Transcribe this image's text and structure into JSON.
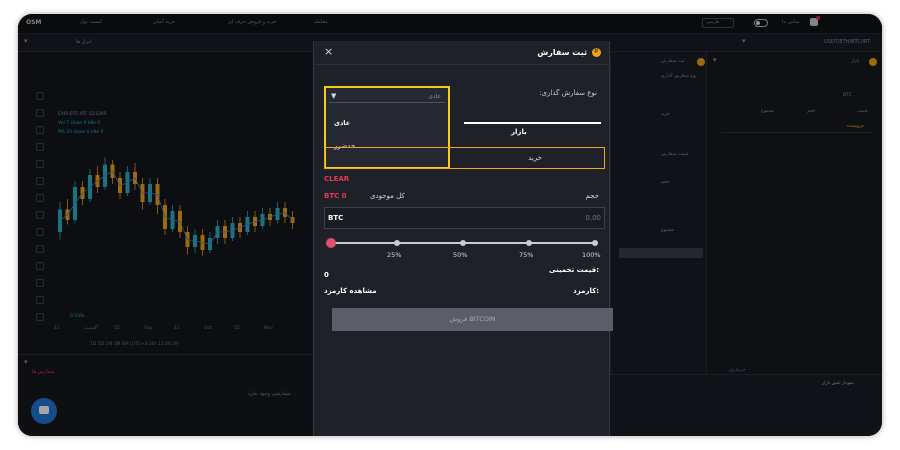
{
  "topbar": {
    "logo": "OSM",
    "items": [
      "لیست پول",
      "خرید آسان",
      "خرید و فروش حرفه ای",
      "معامله"
    ],
    "language": "فارسی",
    "user": "تماس ما"
  },
  "bar2": {
    "left_label": "ابزار ها",
    "pair": "USDT/ETH/BTC/IRT"
  },
  "chart": {
    "ohlc_1": "EXIR:BTC-IRT  1D  EXIR",
    "ohlc_2": "Vol 7 close 0 Idle 0",
    "ohlc_3": "MA 25 close 0 Idle 0",
    "pct": "0.53%",
    "x_labels": [
      "15",
      "آگوست",
      "15",
      "Sep",
      "15",
      "Oct",
      "15",
      "Nov"
    ],
    "range_text": "1D  5D  1M  3M  6M  (UTC+3:30)  12:06:39",
    "candles": [
      [
        0.4,
        0.55,
        0.35,
        0.6
      ],
      [
        0.55,
        0.48,
        0.45,
        0.62
      ],
      [
        0.48,
        0.7,
        0.46,
        0.74
      ],
      [
        0.7,
        0.62,
        0.58,
        0.74
      ],
      [
        0.62,
        0.78,
        0.6,
        0.82
      ],
      [
        0.78,
        0.7,
        0.66,
        0.84
      ],
      [
        0.7,
        0.85,
        0.68,
        0.9
      ],
      [
        0.85,
        0.76,
        0.72,
        0.88
      ],
      [
        0.76,
        0.66,
        0.62,
        0.8
      ],
      [
        0.66,
        0.8,
        0.64,
        0.84
      ],
      [
        0.8,
        0.72,
        0.68,
        0.86
      ],
      [
        0.72,
        0.6,
        0.55,
        0.76
      ],
      [
        0.6,
        0.72,
        0.58,
        0.76
      ],
      [
        0.72,
        0.58,
        0.52,
        0.76
      ],
      [
        0.58,
        0.42,
        0.38,
        0.62
      ],
      [
        0.42,
        0.54,
        0.4,
        0.58
      ],
      [
        0.54,
        0.4,
        0.36,
        0.58
      ],
      [
        0.4,
        0.3,
        0.25,
        0.44
      ],
      [
        0.3,
        0.38,
        0.26,
        0.42
      ],
      [
        0.38,
        0.28,
        0.24,
        0.42
      ],
      [
        0.28,
        0.36,
        0.26,
        0.4
      ],
      [
        0.36,
        0.44,
        0.32,
        0.48
      ],
      [
        0.44,
        0.36,
        0.32,
        0.48
      ],
      [
        0.36,
        0.46,
        0.34,
        0.5
      ],
      [
        0.46,
        0.4,
        0.36,
        0.5
      ],
      [
        0.4,
        0.5,
        0.38,
        0.54
      ],
      [
        0.5,
        0.44,
        0.4,
        0.54
      ],
      [
        0.44,
        0.52,
        0.42,
        0.56
      ],
      [
        0.52,
        0.48,
        0.44,
        0.56
      ],
      [
        0.48,
        0.56,
        0.46,
        0.6
      ],
      [
        0.56,
        0.5,
        0.46,
        0.6
      ],
      [
        0.5,
        0.46,
        0.42,
        0.54
      ]
    ]
  },
  "bottom": {
    "title": "سفارش های باز",
    "empty": "سفارشی وجود ندارد",
    "tab": "سفارش ها"
  },
  "modal": {
    "title": "ثبت سفارش",
    "order_type_label": "نوع سفارش گذاری:",
    "dropdown_value": "عادی",
    "option_1": "عادی",
    "option_2": "حدضرر",
    "tab_market": "بازار",
    "buy_label": "خرید",
    "clear_label": "CLEAR",
    "available_label": "کل موجودی",
    "available_value": "BTC 0",
    "volume_label": "حجم",
    "amount_unit": "BTC",
    "amount_value": "0.00",
    "slider_ticks": [
      "25%",
      "50%",
      "75%",
      "100%"
    ],
    "estimated_label": "قیمت تخمینی:",
    "estimated_value": "0",
    "fee_label": "کارمزد:",
    "fee_link": "مشاهده کارمزد",
    "sell_button": "فروش BITCOIN"
  },
  "midright": {
    "title": "ثبت سفارش",
    "tab": "نوع سفارش گذاری",
    "buy": "خرید",
    "price": "قیمت سفارش",
    "amount": "حجم",
    "total": "مجموع"
  },
  "rightpane": {
    "title": "بازار",
    "fav": "BTC",
    "headers": [
      "قیمت",
      "حجم",
      "مجموع"
    ],
    "sub_label": "فروشنده",
    "buyers_label": "خریداران"
  },
  "depth": {
    "title": "نمودار عمق بازار"
  },
  "colors": {
    "accent": "#f5cf16",
    "orange": "#f2a516",
    "red": "#e83a52",
    "bg": "#1e2128"
  }
}
